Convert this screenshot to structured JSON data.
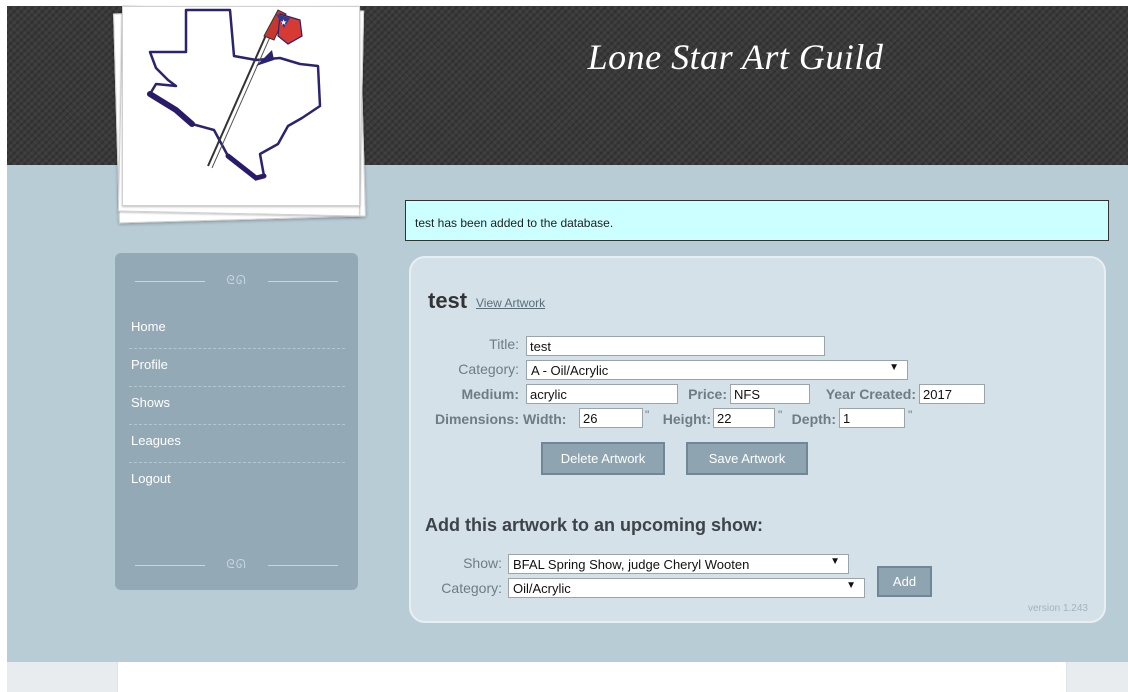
{
  "site": {
    "title": "Lone Star Art Guild"
  },
  "sidebar": {
    "items": [
      {
        "label": "Home"
      },
      {
        "label": "Profile"
      },
      {
        "label": "Shows"
      },
      {
        "label": "Leagues"
      },
      {
        "label": "Logout"
      }
    ]
  },
  "notice": {
    "text": "test has been added to the database."
  },
  "artwork": {
    "heading": "test",
    "view_link": "View Artwork",
    "fields": {
      "title_label": "Title:",
      "title_value": "test",
      "category_label": "Category:",
      "category_value": "A - Oil/Acrylic",
      "medium_label": "Medium:",
      "medium_value": "acrylic",
      "price_label": "Price:",
      "price_value": "NFS",
      "year_label": "Year Created:",
      "year_value": "2017",
      "dimensions_label": "Dimensions:",
      "width_label": "Width:",
      "width_value": "26",
      "height_label": "Height:",
      "height_value": "22",
      "depth_label": "Depth:",
      "depth_value": "1",
      "inch_mark": "\""
    },
    "buttons": {
      "delete": "Delete Artwork",
      "save": "Save Artwork"
    }
  },
  "show_section": {
    "heading": "Add this artwork to an upcoming show:",
    "show_label": "Show:",
    "show_value": "BFAL Spring Show, judge Cheryl Wooten",
    "category_label": "Category:",
    "category_value": "Oil/Acrylic",
    "add_button": "Add"
  },
  "version": "version 1.243",
  "colors": {
    "header": "#3a3a3a",
    "content_band": "#b8ccd6",
    "sidebar": "#93a9b6",
    "panel": "#d4e1e8",
    "notice": "#ccffff",
    "button": "#8ea4b1"
  },
  "icons": {
    "select_arrow": "▼",
    "flourish": "ornament"
  }
}
